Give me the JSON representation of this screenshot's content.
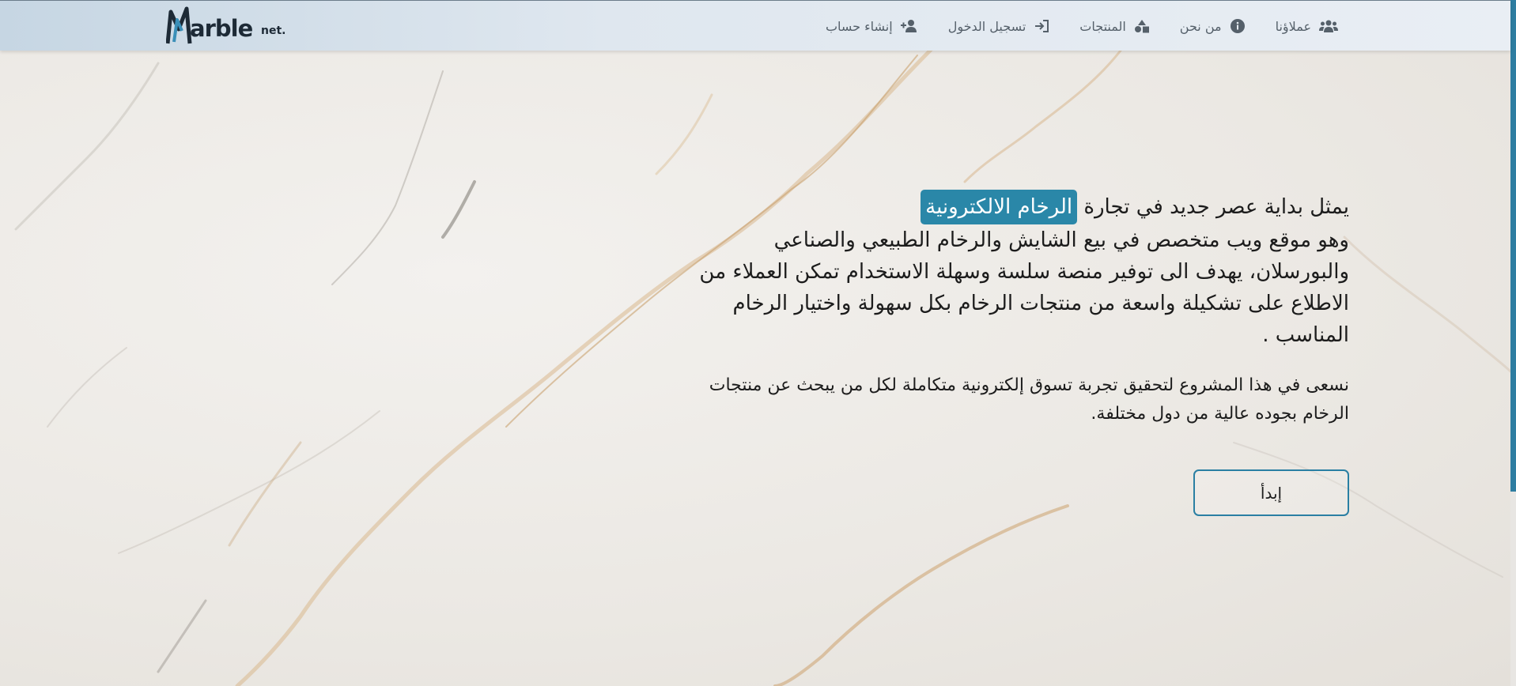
{
  "brand": {
    "logo_text": "arble",
    "logo_suffix": "net."
  },
  "nav": {
    "items": [
      {
        "label": "إنشاء حساب",
        "icon": "user-plus-icon"
      },
      {
        "label": "تسجيل الدخول",
        "icon": "sign-in-icon"
      },
      {
        "label": "المنتجات",
        "icon": "shapes-icon"
      },
      {
        "label": "من نحن",
        "icon": "info-circle-icon"
      },
      {
        "label": "عملاؤنا",
        "icon": "users-icon"
      }
    ]
  },
  "hero": {
    "line1_prefix": "يمثل بداية عصر جديد في تجارة",
    "highlight": "الرخام الالكترونية",
    "paragraph1_rest": "وهو موقع ويب متخصص في بيع الشايش والرخام الطبيعي والصناعي والبورسلان، يهدف الى توفير منصة سلسة وسهلة الاستخدام تمكن العملاء من الاطلاع على تشكيلة واسعة من منتجات الرخام بكل سهولة واختيار الرخام المناسب .",
    "paragraph2": "نسعى في هذا المشروع لتحقيق تجربة تسوق إلكترونية متكاملة لكل من يبحث عن منتجات الرخام بجوده عالية من دول مختلفة.",
    "button_label": "إبدأ"
  },
  "colors": {
    "accent": "#2a87a8",
    "nav_text": "#55606a",
    "scrollbar": "#2e7da1"
  }
}
